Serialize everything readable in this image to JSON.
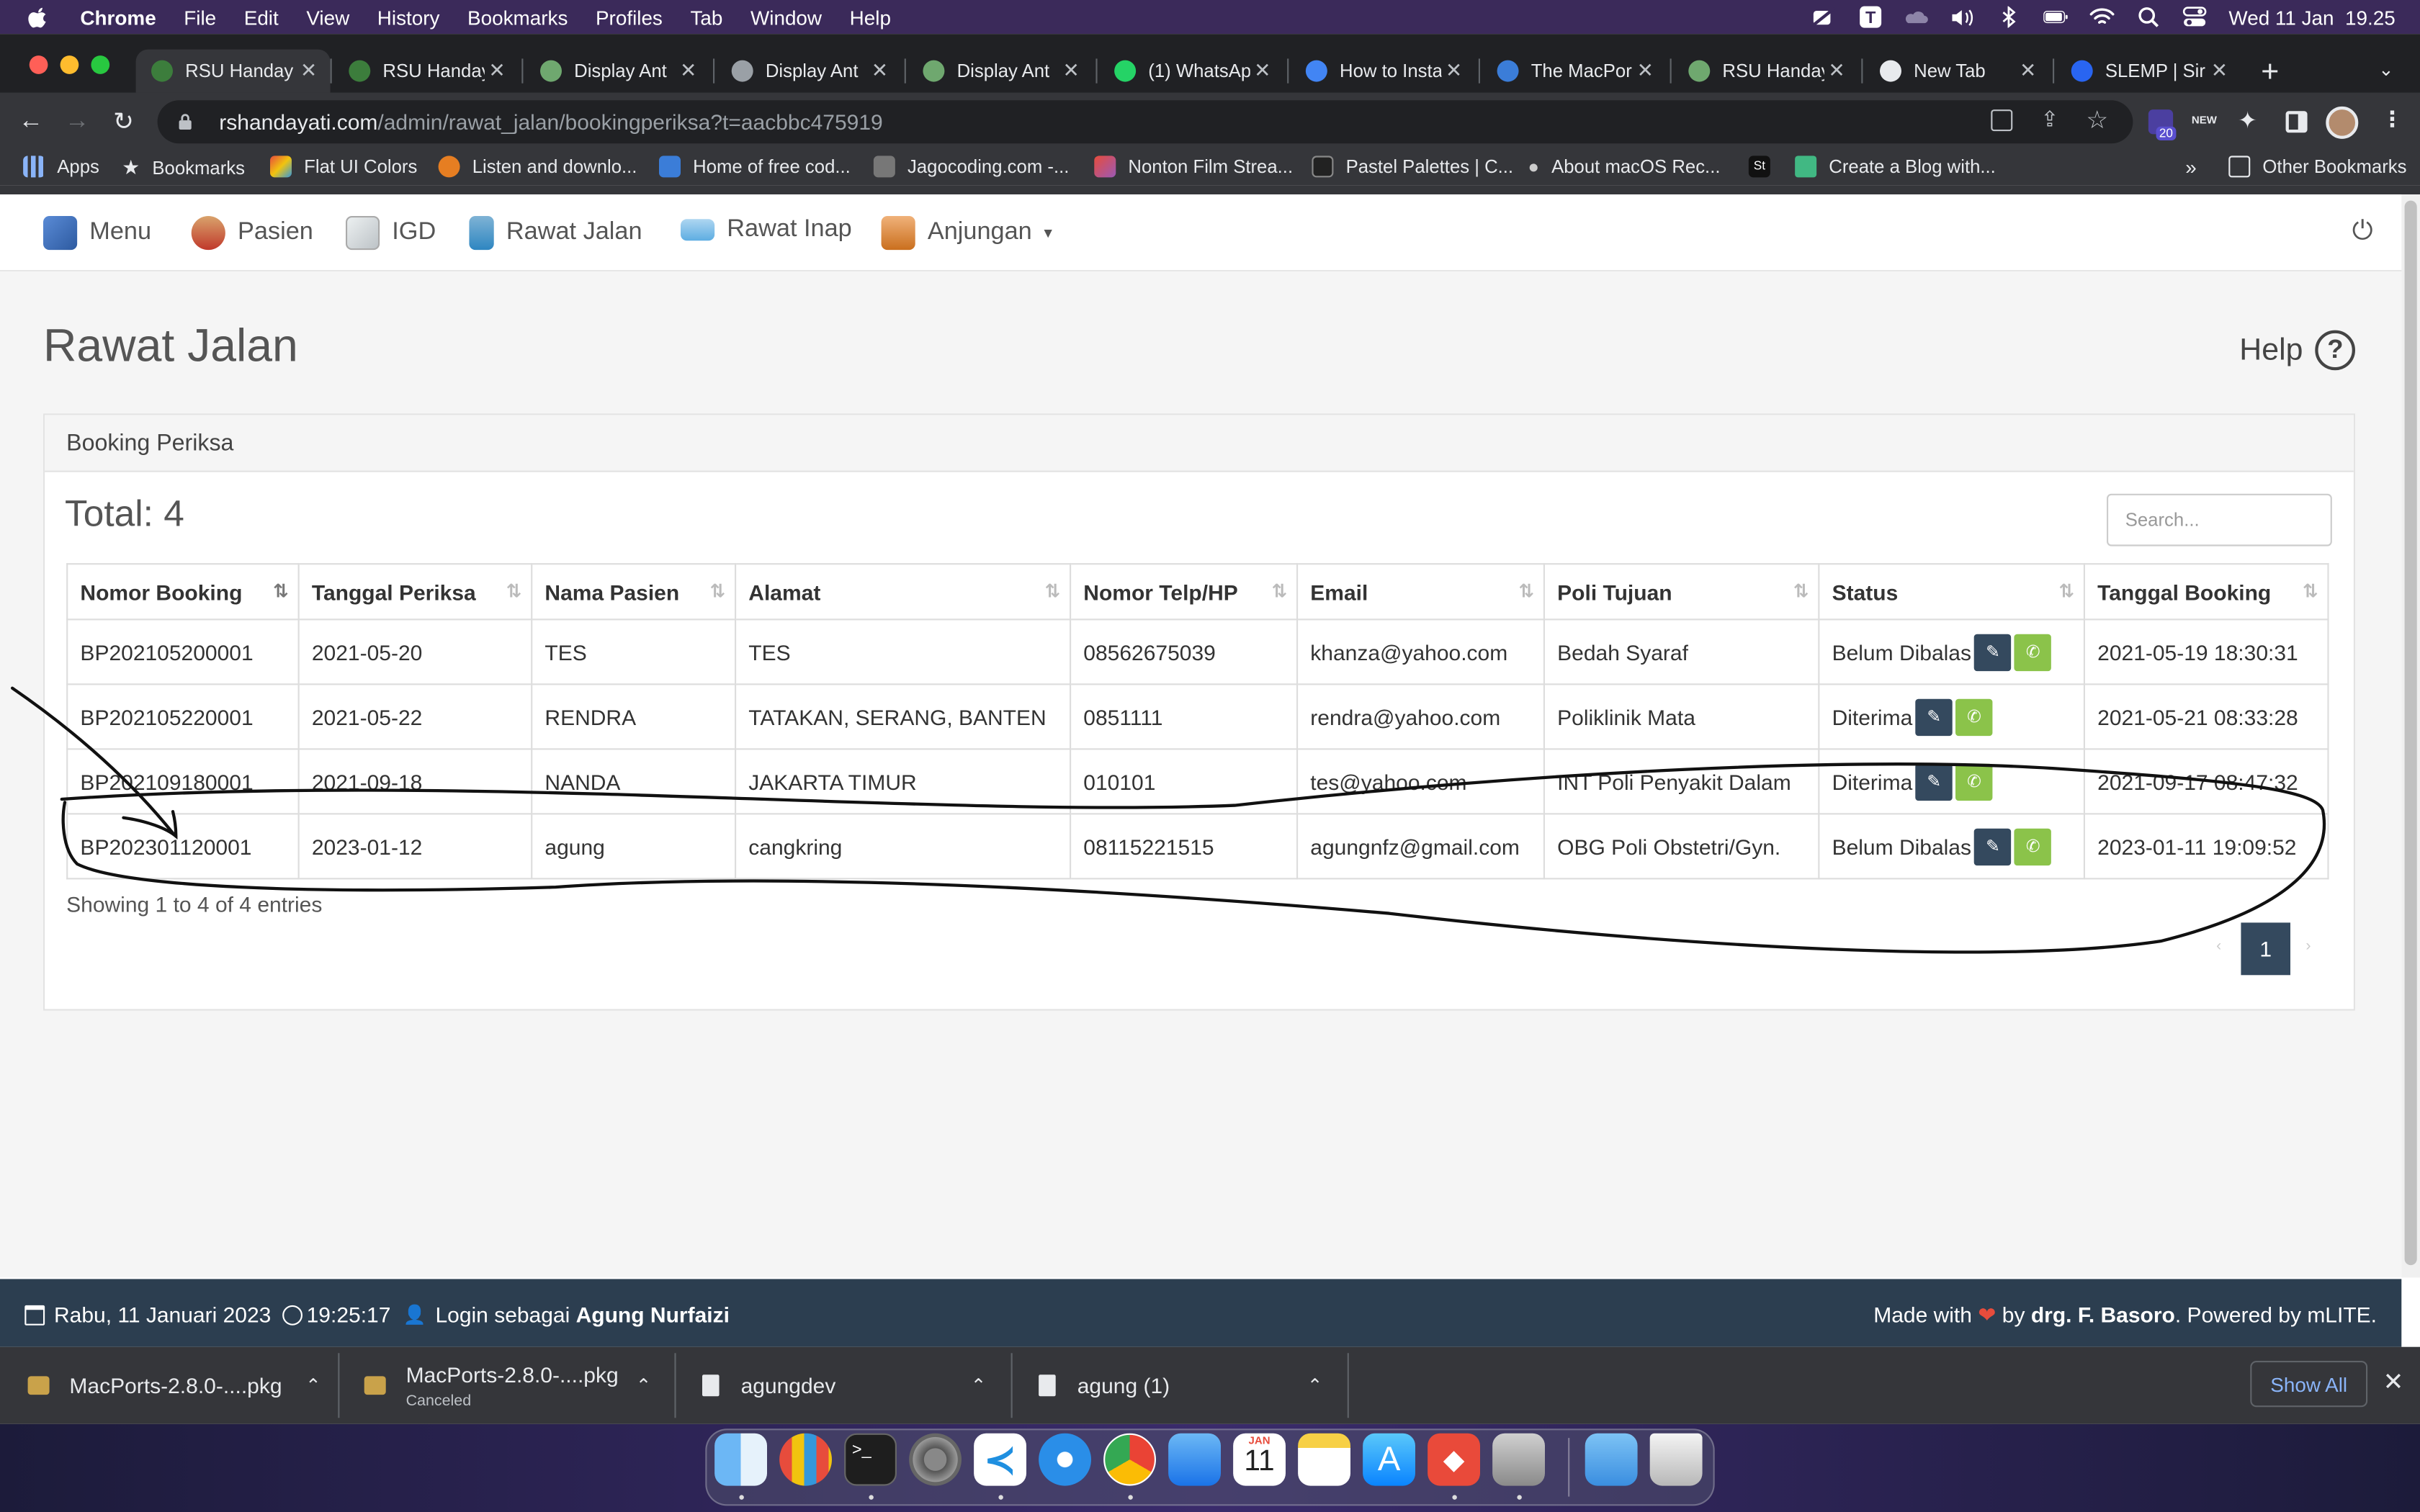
{
  "menubar": {
    "app": "Chrome",
    "items": [
      "File",
      "Edit",
      "View",
      "History",
      "Bookmarks",
      "Profiles",
      "Tab",
      "Window",
      "Help"
    ],
    "clock": "Wed 11 Jan  19.25"
  },
  "browser": {
    "tabs": [
      {
        "title": "RSU Handay",
        "active": true,
        "favicon_color": "#3c7d3c"
      },
      {
        "title": "RSU Handay",
        "favicon_color": "#3c7d3c"
      },
      {
        "title": "Display Ant",
        "favicon_color": "#6fa86f"
      },
      {
        "title": "Display Ant",
        "favicon_color": "#9aa0a6"
      },
      {
        "title": "Display Ant",
        "favicon_color": "#6fa86f"
      },
      {
        "title": "(1) WhatsAp",
        "favicon_color": "#25d366"
      },
      {
        "title": "How to Insta",
        "favicon_color": "#4285f4"
      },
      {
        "title": "The MacPor",
        "favicon_color": "#3b7dd8"
      },
      {
        "title": "RSU Handay",
        "favicon_color": "#6fa86f"
      },
      {
        "title": "New Tab",
        "favicon_color": "#e8eaed"
      },
      {
        "title": "SLEMP | Sir",
        "favicon_color": "#2965f1"
      }
    ],
    "url_host": "rshandayati.com",
    "url_path": "/admin/rawat_jalan/bookingperiksa?t=aacbbc475919",
    "extension_badge": "20",
    "extension_new": "NEW",
    "bookmarks": [
      "Apps",
      "Bookmarks",
      "Flat UI Colors",
      "Listen and downlo...",
      "Home of free cod...",
      "Jagocoding.com -...",
      "Nonton Film Strea...",
      "Pastel Palettes | C...",
      "About macOS Rec...",
      "St",
      "Create a Blog with..."
    ],
    "other_bookmarks": "Other Bookmarks",
    "overflow": "»"
  },
  "appnav": {
    "items": [
      "Menu",
      "Pasien",
      "IGD",
      "Rawat Jalan",
      "Rawat Inap",
      "Anjungan"
    ]
  },
  "page": {
    "title": "Rawat Jalan",
    "help_label": "Help",
    "panel_title": "Booking Periksa",
    "total_label": "Total: 4",
    "search_placeholder": "Search...",
    "showing": "Showing 1 to 4 of 4 entries",
    "current_page": "1"
  },
  "table": {
    "headers": [
      "Nomor Booking",
      "Tanggal Periksa",
      "Nama Pasien",
      "Alamat",
      "Nomor Telp/HP",
      "Email",
      "Poli Tujuan",
      "Status",
      "Tanggal Booking"
    ],
    "rows": [
      [
        "BP202105200001",
        "2021-05-20",
        "TES",
        "TES",
        "08562675039",
        "khanza@yahoo.com",
        "Bedah Syaraf",
        "Belum Dibalas",
        "2021-05-19 18:30:31"
      ],
      [
        "BP202105220001",
        "2021-05-22",
        "RENDRA",
        "TATAKAN, SERANG, BANTEN",
        "0851111",
        "rendra@yahoo.com",
        "Poliklinik Mata",
        "Diterima",
        "2021-05-21 08:33:28"
      ],
      [
        "BP202109180001",
        "2021-09-18",
        "NANDA",
        "JAKARTA TIMUR",
        "010101",
        "tes@yahoo.com",
        "INT Poli Penyakit Dalam",
        "Diterima",
        "2021-09-17 08:47:32"
      ],
      [
        "BP202301120001",
        "2023-01-12",
        "agung",
        "cangkring",
        "08115221515",
        "agungnfz@gmail.com",
        "OBG Poli Obstetri/Gyn.",
        "Belum Dibalas",
        "2023-01-11 19:09:52"
      ]
    ]
  },
  "footer": {
    "date": "Rabu, 11 Januari 2023",
    "time": "19:25:17",
    "login_prefix": "Login sebagai",
    "user": "Agung Nurfaizi",
    "made_with": "Made with",
    "by": "by",
    "author": "drg. F. Basoro",
    "powered": ". Powered by mLITE."
  },
  "downloads": {
    "items": [
      {
        "name": "MacPorts-2.8.0-....pkg",
        "status": ""
      },
      {
        "name": "MacPorts-2.8.0-....pkg",
        "status": "Canceled"
      },
      {
        "name": "agungdev",
        "status": ""
      },
      {
        "name": "agung (1)",
        "status": ""
      }
    ],
    "show_all": "Show All"
  },
  "dock": {
    "calendar_month": "JAN",
    "calendar_day": "11"
  },
  "colors": {
    "menubar_bg": "#3b2a5a",
    "chrome_dark": "#202124",
    "chrome_toolbar": "#35363a",
    "footer_bg": "#2c3e50",
    "button_dark": "#34495e",
    "button_green": "#8bc34a"
  }
}
